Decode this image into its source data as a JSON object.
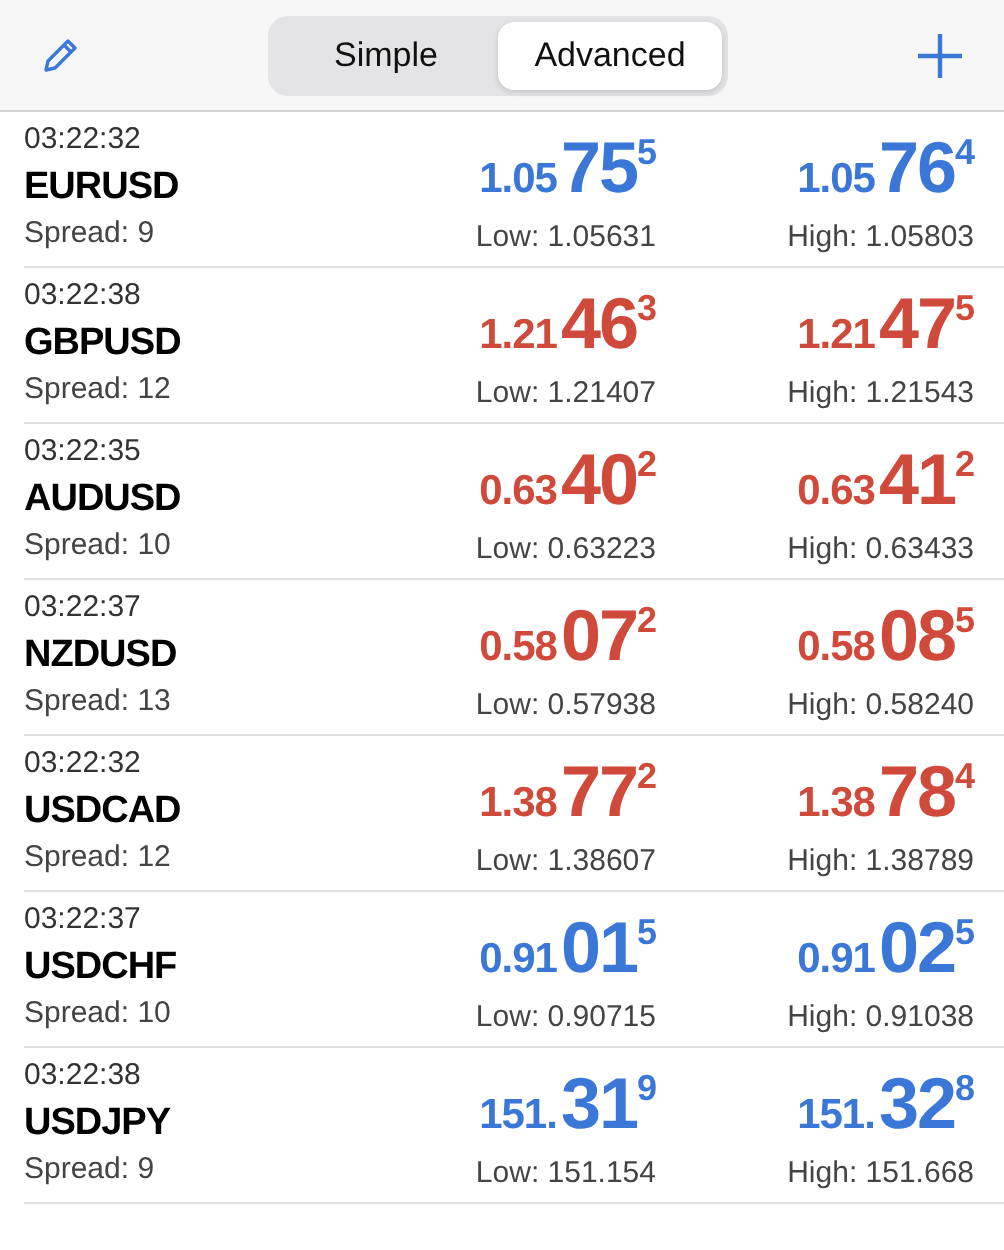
{
  "toolbar": {
    "segments": [
      {
        "label": "Simple",
        "selected": false
      },
      {
        "label": "Advanced",
        "selected": true
      }
    ]
  },
  "quotes": [
    {
      "time": "03:22:32",
      "symbol": "EURUSD",
      "spread": "Spread: 9",
      "bid": {
        "color": "#3b77d6",
        "prefix": "1.05",
        "pips": "75",
        "point": "5"
      },
      "ask": {
        "color": "#3b77d6",
        "prefix": "1.05",
        "pips": "76",
        "point": "4"
      },
      "low": "Low: 1.05631",
      "high": "High: 1.05803"
    },
    {
      "time": "03:22:38",
      "symbol": "GBPUSD",
      "spread": "Spread: 12",
      "bid": {
        "color": "#cf4a3a",
        "prefix": "1.21",
        "pips": "46",
        "point": "3"
      },
      "ask": {
        "color": "#cf4a3a",
        "prefix": "1.21",
        "pips": "47",
        "point": "5"
      },
      "low": "Low: 1.21407",
      "high": "High: 1.21543"
    },
    {
      "time": "03:22:35",
      "symbol": "AUDUSD",
      "spread": "Spread: 10",
      "bid": {
        "color": "#cf4a3a",
        "prefix": "0.63",
        "pips": "40",
        "point": "2"
      },
      "ask": {
        "color": "#cf4a3a",
        "prefix": "0.63",
        "pips": "41",
        "point": "2"
      },
      "low": "Low: 0.63223",
      "high": "High: 0.63433"
    },
    {
      "time": "03:22:37",
      "symbol": "NZDUSD",
      "spread": "Spread: 13",
      "bid": {
        "color": "#cf4a3a",
        "prefix": "0.58",
        "pips": "07",
        "point": "2"
      },
      "ask": {
        "color": "#cf4a3a",
        "prefix": "0.58",
        "pips": "08",
        "point": "5"
      },
      "low": "Low: 0.57938",
      "high": "High: 0.58240"
    },
    {
      "time": "03:22:32",
      "symbol": "USDCAD",
      "spread": "Spread: 12",
      "bid": {
        "color": "#cf4a3a",
        "prefix": "1.38",
        "pips": "77",
        "point": "2"
      },
      "ask": {
        "color": "#cf4a3a",
        "prefix": "1.38",
        "pips": "78",
        "point": "4"
      },
      "low": "Low: 1.38607",
      "high": "High: 1.38789"
    },
    {
      "time": "03:22:37",
      "symbol": "USDCHF",
      "spread": "Spread: 10",
      "bid": {
        "color": "#3b77d6",
        "prefix": "0.91",
        "pips": "01",
        "point": "5"
      },
      "ask": {
        "color": "#3b77d6",
        "prefix": "0.91",
        "pips": "02",
        "point": "5"
      },
      "low": "Low: 0.90715",
      "high": "High: 0.91038"
    },
    {
      "time": "03:22:38",
      "symbol": "USDJPY",
      "spread": "Spread: 9",
      "bid": {
        "color": "#3b77d6",
        "prefix": "151.",
        "pips": "31",
        "point": "9"
      },
      "ask": {
        "color": "#3b77d6",
        "prefix": "151.",
        "pips": "32",
        "point": "8"
      },
      "low": "Low: 151.154",
      "high": "High: 151.668"
    }
  ]
}
